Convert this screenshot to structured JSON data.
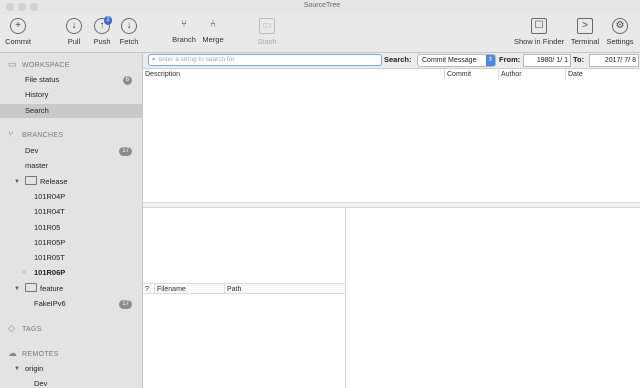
{
  "window": {
    "title": "SourceTree"
  },
  "toolbar": {
    "commit": "Commit",
    "pull": "Pull",
    "push": "Push",
    "push_badge": "2",
    "fetch": "Fetch",
    "branch": "Branch",
    "merge": "Merge",
    "stash": "Stash",
    "show_in_finder": "Show in Finder",
    "terminal": "Terminal",
    "settings": "Settings"
  },
  "sidebar": {
    "workspace": "WORKSPACE",
    "file_status": "File status",
    "file_status_count": "6",
    "history": "History",
    "search": "Search",
    "branches": "BRANCHES",
    "dev": "Dev",
    "dev_count": "17",
    "master": "master",
    "release": "Release",
    "release_branches": [
      "101R04P",
      "101R04T",
      "101R05",
      "101R05P",
      "101R05T",
      "101R06P"
    ],
    "feature": "feature",
    "feature_branch": "FakeIPv6",
    "feature_count": "17",
    "tags": "TAGS",
    "remotes": "REMOTES",
    "origin": "origin",
    "origin_dev": "Dev"
  },
  "filter": {
    "placeholder": "enter a string to search for",
    "search_label": "Search:",
    "mode": "Commit Message",
    "from_label": "From:",
    "from_date": "1980/ 1/ 1",
    "to_label": "To:",
    "to_date": "2017/ 7/ 8"
  },
  "columns": {
    "description": "Description",
    "commit": "Commit",
    "author": "Author",
    "date": "Date"
  },
  "file_columns": {
    "status": "?",
    "filename": "Filename",
    "path": "Path"
  }
}
